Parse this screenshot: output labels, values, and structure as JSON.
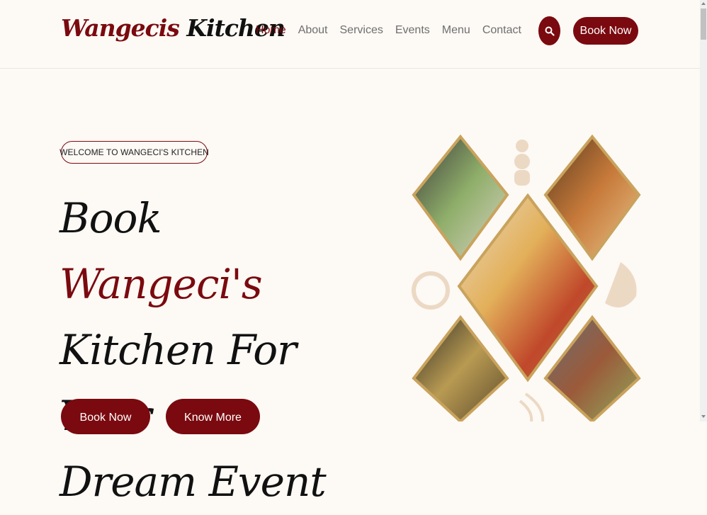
{
  "header": {
    "logo_part1": "Wangecis",
    "logo_part2": "Kitchen",
    "nav": [
      "Home",
      "About",
      "Services",
      "Events",
      "Menu",
      "Contact"
    ],
    "active_nav": "Home",
    "book_label": "Book Now"
  },
  "hero": {
    "badge": "WELCOME TO WANGECI'S KITCHEN",
    "title_1": "Book ",
    "title_accent": "Wangeci's",
    "title_2": "Kitchen For Your",
    "title_3": "Dream Event",
    "cta_book": "Book Now",
    "cta_more": "Know More"
  },
  "collage": {
    "images": [
      "buffet-salad-platters",
      "catering-trays",
      "table-flower-centerpiece",
      "buffet-chafing-dishes",
      "canape-platter"
    ],
    "decorations": [
      "chef-icon",
      "pizza-icon",
      "pizza-slice-icon",
      "steam-icon"
    ]
  },
  "colors": {
    "brand": "#7a0a0f",
    "background": "#fdf9f5",
    "gold_border": "#c9a35d",
    "nav_text": "#6f6f6f"
  }
}
